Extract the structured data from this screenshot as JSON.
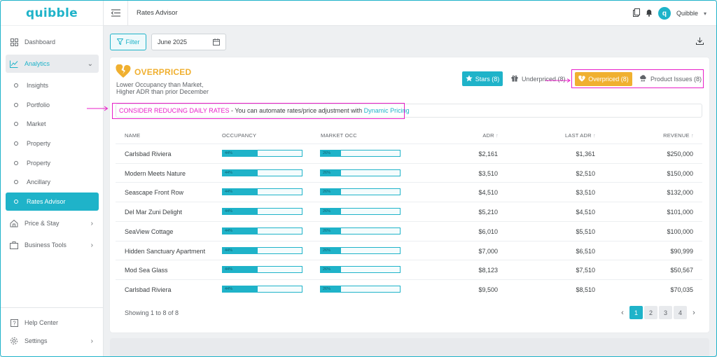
{
  "brand": {
    "logo_text": "quibble",
    "accent": "#1fb3c9",
    "warning": "#f0b030",
    "highlight": "#e81ec8"
  },
  "topbar": {
    "title": "Rates Advisor",
    "user_name": "Quibble",
    "avatar_letter": "q"
  },
  "sidebar": {
    "items": [
      {
        "label": "Dashboard",
        "icon": "dashboard-icon"
      },
      {
        "label": "Analytics",
        "icon": "analytics-icon"
      },
      {
        "label": "Insights"
      },
      {
        "label": "Portfolio"
      },
      {
        "label": "Market"
      },
      {
        "label": "Property"
      },
      {
        "label": "Property"
      },
      {
        "label": "Ancillary"
      },
      {
        "label": "Rates Advisor"
      },
      {
        "label": "Price & Stay",
        "icon": "price-stay-icon"
      },
      {
        "label": "Business Tools",
        "icon": "briefcase-icon"
      },
      {
        "label": "Help Center",
        "icon": "help-icon"
      },
      {
        "label": "Settings",
        "icon": "gear-icon"
      }
    ]
  },
  "toolbar": {
    "filter_label": "Filter",
    "date_value": "June 2025"
  },
  "summary": {
    "title": "OVERPRICED",
    "desc_line1": "Lower Occupancy than Market,",
    "desc_line2": "Higher ADR than prior December"
  },
  "tabs": {
    "stars": "Stars (8)",
    "underpriced": "Underpriced (8)",
    "overpriced": "Overpriced (8)",
    "product_issues": "Product Issues (8)"
  },
  "banner": {
    "headline": "CONSIDER REDUCING DAILY RATES",
    "text": " - You can automate rates/price adjustment with ",
    "link": "Dynamic Pricing"
  },
  "table": {
    "headers": {
      "name": "NAME",
      "occupancy": "OCCUPANCY",
      "market_occ": "MARKET OCC",
      "adr": "ADR",
      "last_adr": "LAST ADR",
      "revenue": "REVENUE"
    },
    "rows": [
      {
        "name": "Carlsbad Riviera",
        "occ": 44,
        "occ_label": "44%",
        "mkt": 26,
        "mkt_label": "26%",
        "adr": "$2,161",
        "last_adr": "$1,361",
        "revenue": "$250,000"
      },
      {
        "name": "Modern Meets Nature",
        "occ": 44,
        "occ_label": "44%",
        "mkt": 26,
        "mkt_label": "26%",
        "adr": "$3,510",
        "last_adr": "$2,510",
        "revenue": "$150,000"
      },
      {
        "name": "Seascape Front Row",
        "occ": 44,
        "occ_label": "44%",
        "mkt": 26,
        "mkt_label": "26%",
        "adr": "$4,510",
        "last_adr": "$3,510",
        "revenue": "$132,000"
      },
      {
        "name": "Del Mar  Zuni Delight",
        "occ": 44,
        "occ_label": "44%",
        "mkt": 26,
        "mkt_label": "26%",
        "adr": "$5,210",
        "last_adr": "$4,510",
        "revenue": "$101,000"
      },
      {
        "name": "SeaView Cottage",
        "occ": 44,
        "occ_label": "44%",
        "mkt": 26,
        "mkt_label": "26%",
        "adr": "$6,010",
        "last_adr": "$5,510",
        "revenue": "$100,000"
      },
      {
        "name": "Hidden Sanctuary Apartment",
        "occ": 44,
        "occ_label": "44%",
        "mkt": 26,
        "mkt_label": "26%",
        "adr": "$7,000",
        "last_adr": "$6,510",
        "revenue": "$90,999"
      },
      {
        "name": "Mod Sea Glass",
        "occ": 44,
        "occ_label": "44%",
        "mkt": 26,
        "mkt_label": "26%",
        "adr": "$8,123",
        "last_adr": "$7,510",
        "revenue": "$50,567"
      },
      {
        "name": "Carlsbad Riviera",
        "occ": 44,
        "occ_label": "44%",
        "mkt": 26,
        "mkt_label": "26%",
        "adr": "$9,500",
        "last_adr": "$8,510",
        "revenue": "$70,035"
      }
    ]
  },
  "footer": {
    "showing": "Showing 1 to 8 of 8",
    "pages": [
      "1",
      "2",
      "3",
      "4"
    ],
    "prev": "‹",
    "next": "›"
  }
}
